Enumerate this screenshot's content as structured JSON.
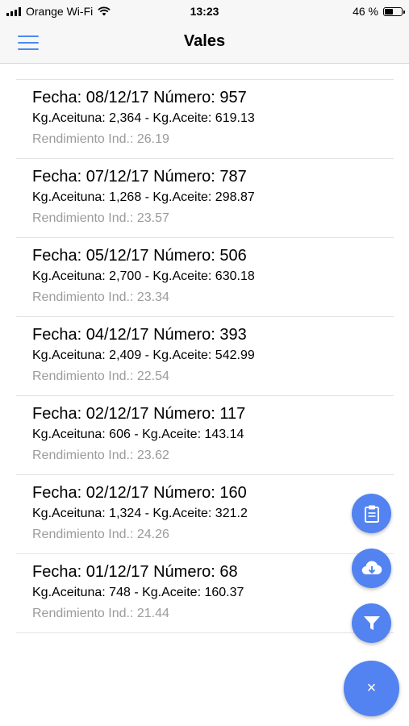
{
  "status": {
    "carrier": "Orange Wi-Fi",
    "time": "13:23",
    "battery": "46 %",
    "battery_level": 0.46
  },
  "nav": {
    "title": "Vales"
  },
  "items": [
    {
      "title": "Fecha: 08/12/17 Número: 957",
      "sub": "Kg.Aceituna: 2,364 - Kg.Aceite: 619.13",
      "meta": "Rendimiento Ind.: 26.19"
    },
    {
      "title": "Fecha: 07/12/17 Número: 787",
      "sub": "Kg.Aceituna: 1,268 - Kg.Aceite: 298.87",
      "meta": "Rendimiento Ind.: 23.57"
    },
    {
      "title": "Fecha: 05/12/17 Número: 506",
      "sub": "Kg.Aceituna: 2,700 - Kg.Aceite: 630.18",
      "meta": "Rendimiento Ind.: 23.34"
    },
    {
      "title": "Fecha: 04/12/17 Número: 393",
      "sub": "Kg.Aceituna: 2,409 - Kg.Aceite: 542.99",
      "meta": "Rendimiento Ind.: 22.54"
    },
    {
      "title": "Fecha: 02/12/17 Número: 117",
      "sub": "Kg.Aceituna: 606 - Kg.Aceite: 143.14",
      "meta": "Rendimiento Ind.: 23.62"
    },
    {
      "title": "Fecha: 02/12/17 Número: 160",
      "sub": "Kg.Aceituna: 1,324 - Kg.Aceite: 321.2",
      "meta": "Rendimiento Ind.: 24.26"
    },
    {
      "title": "Fecha: 01/12/17 Número: 68",
      "sub": "Kg.Aceituna: 748 - Kg.Aceite: 160.37",
      "meta": "Rendimiento Ind.: 21.44"
    }
  ],
  "fab": {
    "close_symbol": "×",
    "icons": [
      "clipboard-icon",
      "cloud-download-icon",
      "filter-icon",
      "close-icon"
    ],
    "color": "#5283f0"
  },
  "colors": {
    "accent": "#4a8af4",
    "meta_text": "#9b9b9b"
  }
}
